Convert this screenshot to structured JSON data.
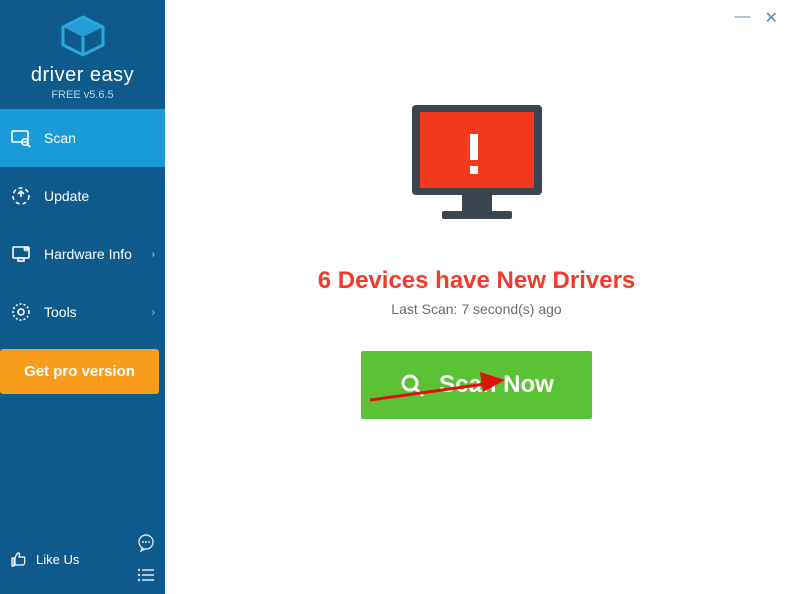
{
  "brand": {
    "name": "driver easy",
    "version": "FREE v5.6.5"
  },
  "sidebar": {
    "items": [
      {
        "label": "Scan",
        "icon": "scan-icon",
        "active": true,
        "chevron": false
      },
      {
        "label": "Update",
        "icon": "update-icon",
        "active": false,
        "chevron": false
      },
      {
        "label": "Hardware Info",
        "icon": "hardware-icon",
        "active": false,
        "chevron": true
      },
      {
        "label": "Tools",
        "icon": "tools-icon",
        "active": false,
        "chevron": true
      }
    ],
    "pro_button": "Get pro version",
    "like_us": "Like Us"
  },
  "main": {
    "headline": "6 Devices have New Drivers",
    "subtext": "Last Scan: 7 second(s) ago",
    "scan_button": "Scan Now"
  },
  "colors": {
    "sidebar": "#0f5a8c",
    "active": "#1a9bd8",
    "pro": "#f89c1c",
    "alert": "#f13b2d",
    "scan_btn": "#5bc236"
  }
}
